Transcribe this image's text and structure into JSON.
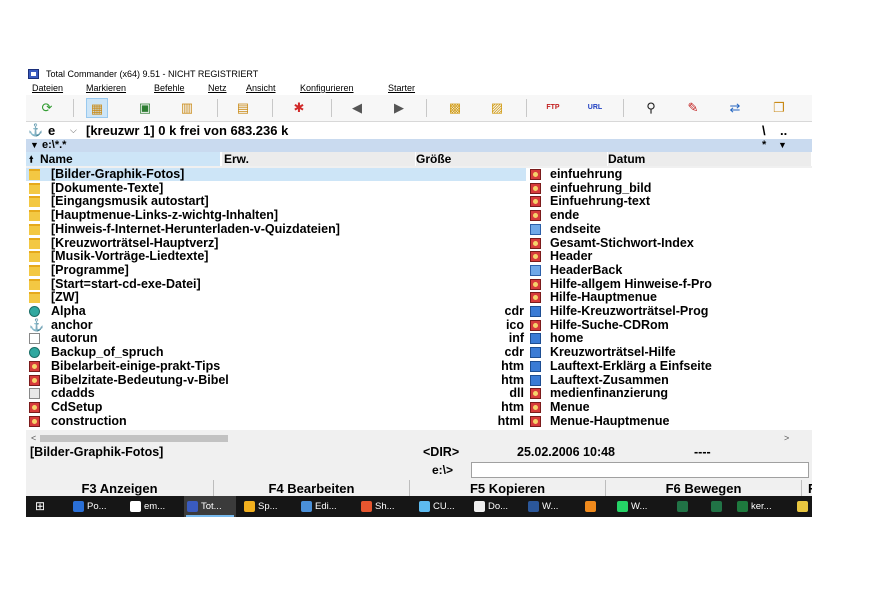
{
  "window": {
    "title": "Total Commander (x64) 9.51 - NICHT REGISTRIERT"
  },
  "menu": [
    "Dateien",
    "Markieren",
    "Befehle",
    "Netz",
    "Ansicht",
    "Konfigurieren",
    "Starter"
  ],
  "toolbar": {
    "icons": [
      "refresh-icon",
      "brief-view-icon",
      "thumbnail-view-icon",
      "tree-view-icon",
      "directory-tree-icon",
      "invert-selection-icon",
      "back-icon",
      "forward-icon",
      "pack-icon",
      "unpack-icon",
      "ftp-icon",
      "url-icon",
      "find-icon",
      "multi-rename-icon",
      "sync-dirs-icon",
      "copy-names-icon"
    ],
    "ftp_label": "FTP",
    "url_label": "URL"
  },
  "drive": {
    "letter": "e",
    "info": "[kreuzwr 1]  0 k frei von 683.236 k",
    "root_btn": "\\",
    "up_btn": ".."
  },
  "path": {
    "value": "e:\\*.*",
    "right": "*"
  },
  "columns": {
    "name": "Name",
    "ext": "Erw.",
    "size": "Größe",
    "date": "Datum"
  },
  "left_files": [
    {
      "name": "[Bilder-Graphik-Fotos]",
      "ext": "",
      "icon": "folder"
    },
    {
      "name": "[Dokumente-Texte]",
      "ext": "",
      "icon": "folder"
    },
    {
      "name": "[Eingangsmusik autostart]",
      "ext": "",
      "icon": "folder"
    },
    {
      "name": "[Hauptmenue-Links-z-wichtg-Inhalten]",
      "ext": "",
      "icon": "folder"
    },
    {
      "name": "[Hinweis-f-Internet-Herunterladen-v-Quizdateien]",
      "ext": "",
      "icon": "folder"
    },
    {
      "name": "[Kreuzworträtsel-Hauptverz]",
      "ext": "",
      "icon": "folder"
    },
    {
      "name": "[Musik-Vorträge-Liedtexte]",
      "ext": "",
      "icon": "folder"
    },
    {
      "name": "[Programme]",
      "ext": "",
      "icon": "folder"
    },
    {
      "name": "[Start=start-cd-exe-Datei]",
      "ext": "",
      "icon": "folder"
    },
    {
      "name": "[ZW]",
      "ext": "",
      "icon": "folder"
    },
    {
      "name": "Alpha",
      "ext": "cdr",
      "icon": "cdr"
    },
    {
      "name": "anchor",
      "ext": "ico",
      "icon": "ico-anchor"
    },
    {
      "name": "autorun",
      "ext": "inf",
      "icon": "inf"
    },
    {
      "name": "Backup_of_spruch",
      "ext": "cdr",
      "icon": "cdr"
    },
    {
      "name": "Bibelarbeit-einige-prakt-Tips",
      "ext": "htm",
      "icon": "htm"
    },
    {
      "name": "Bibelzitate-Bedeutung-v-Bibel",
      "ext": "htm",
      "icon": "htm"
    },
    {
      "name": "cdadds",
      "ext": "dll",
      "icon": "dll"
    },
    {
      "name": "CdSetup",
      "ext": "htm",
      "icon": "htm"
    },
    {
      "name": "construction",
      "ext": "html",
      "icon": "htm"
    }
  ],
  "right_files": [
    {
      "name": "einfuehrung",
      "icon": "htm"
    },
    {
      "name": "einfuehrung_bild",
      "icon": "htm"
    },
    {
      "name": "Einfuehrung-text",
      "icon": "htm"
    },
    {
      "name": "ende",
      "icon": "htm"
    },
    {
      "name": "endseite",
      "icon": "img"
    },
    {
      "name": "Gesamt-Stichwort-Index",
      "icon": "htm"
    },
    {
      "name": "Header",
      "icon": "htm"
    },
    {
      "name": "HeaderBack",
      "icon": "img"
    },
    {
      "name": "Hilfe-allgem Hinweise-f-Pro",
      "icon": "htm"
    },
    {
      "name": "Hilfe-Hauptmenue",
      "icon": "htm"
    },
    {
      "name": "Hilfe-Kreuzworträtsel-Prog",
      "icon": "gif"
    },
    {
      "name": "Hilfe-Suche-CDRom",
      "icon": "htm"
    },
    {
      "name": "home",
      "icon": "gif"
    },
    {
      "name": "Kreuzworträtsel-Hilfe",
      "icon": "gif"
    },
    {
      "name": "Lauftext-Erklärg a Einfseite",
      "icon": "gif"
    },
    {
      "name": "Lauftext-Zusammen",
      "icon": "gif"
    },
    {
      "name": "medienfinanzierung",
      "icon": "htm"
    },
    {
      "name": "Menue",
      "icon": "htm"
    },
    {
      "name": "Menue-Hauptmenue",
      "icon": "htm"
    }
  ],
  "status": {
    "name": "[Bilder-Graphik-Fotos]",
    "size": "<DIR>",
    "date": "25.02.2006 10:48",
    "attr": "----"
  },
  "cmdline": {
    "prompt": "e:\\>"
  },
  "fkeys": [
    "F3 Anzeigen",
    "F4 Bearbeiten",
    "F5 Kopieren",
    "F6 Bewegen",
    "F"
  ],
  "taskbar": [
    {
      "label": "Po...",
      "color": "#2a6fd6"
    },
    {
      "label": "em...",
      "color": "#ffffff"
    },
    {
      "label": "Tot...",
      "color": "#3a5bbf"
    },
    {
      "label": "Sp...",
      "color": "#f2b01e"
    },
    {
      "label": "Edi...",
      "color": "#4a90d9"
    },
    {
      "label": "Sh...",
      "color": "#e5562f"
    },
    {
      "label": "CU...",
      "color": "#5dbbf0"
    },
    {
      "label": "Do...",
      "color": "#f0f0f0"
    },
    {
      "label": "W...",
      "color": "#2b579a"
    },
    {
      "label": "",
      "color": "#f08a1c"
    },
    {
      "label": "W...",
      "color": "#25d366"
    },
    {
      "label": "",
      "color": "#217346"
    },
    {
      "label": "",
      "color": "#217346"
    },
    {
      "label": "ker...",
      "color": "#1e7a3e"
    },
    {
      "label": "",
      "color": "#e8c640"
    }
  ]
}
